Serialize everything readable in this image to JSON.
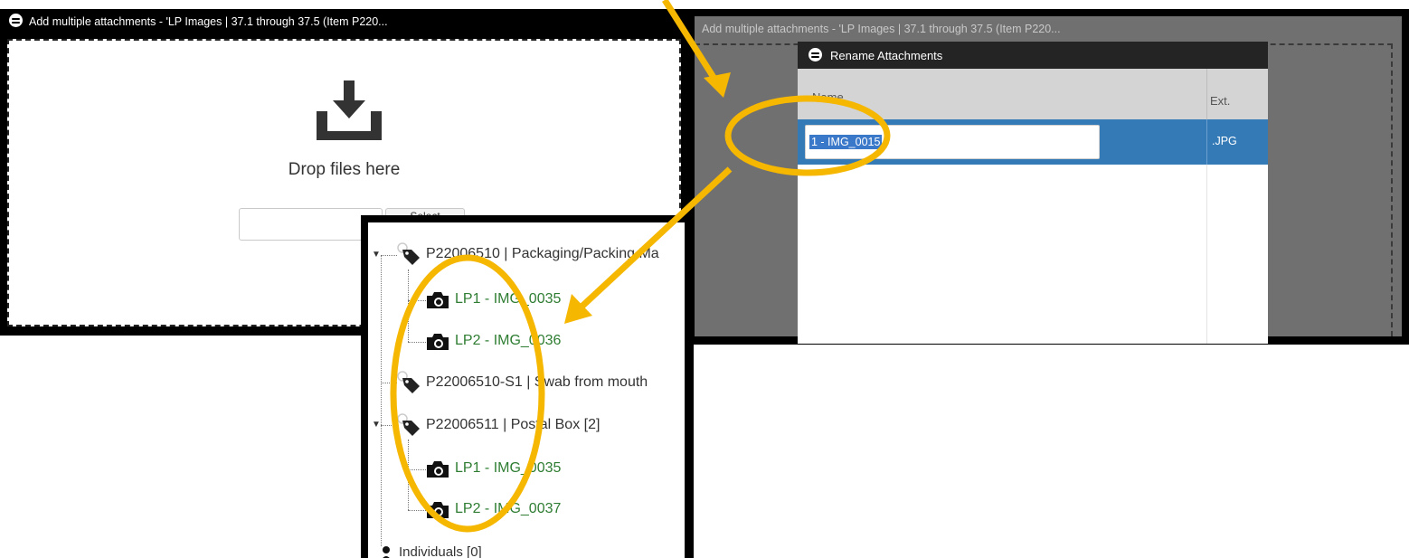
{
  "left_window": {
    "title": "Add multiple attachments - 'LP Images | 37.1 through 37.5 (Item P220...",
    "drop_text": "Drop files here",
    "select_label": "Select"
  },
  "right_window": {
    "title": "Add multiple attachments - 'LP Images | 37.1 through 37.5 (Item P220...",
    "dialog_title": "Rename Attachments",
    "col_name": "Name",
    "col_ext": "Ext.",
    "row": {
      "name_value": "1 - IMG_0015",
      "ext": ".JPG"
    }
  },
  "tree": {
    "items": [
      {
        "kind": "group",
        "label": "P22006510 | Packaging/Packing Ma"
      },
      {
        "kind": "child",
        "label": "LP1 - IMG_0035"
      },
      {
        "kind": "child",
        "label": "LP2 - IMG_0036"
      },
      {
        "kind": "group",
        "label": "P22006510-S1 | Swab from mouth"
      },
      {
        "kind": "group",
        "label": "P22006511 | Postal Box [2]"
      },
      {
        "kind": "child",
        "label": "LP1 - IMG_0035"
      },
      {
        "kind": "child",
        "label": "LP2 - IMG_0037"
      },
      {
        "kind": "group",
        "label": "Individuals [0]"
      }
    ]
  },
  "icons": {
    "download": "download-tray-icon",
    "tag": "tag-icon",
    "camera": "camera-icon",
    "person": "person-icon",
    "logo": "app-logo-icon"
  },
  "colors": {
    "highlight": "#f5b700",
    "selection": "#337ab7",
    "child_text": "#2e7d32"
  }
}
